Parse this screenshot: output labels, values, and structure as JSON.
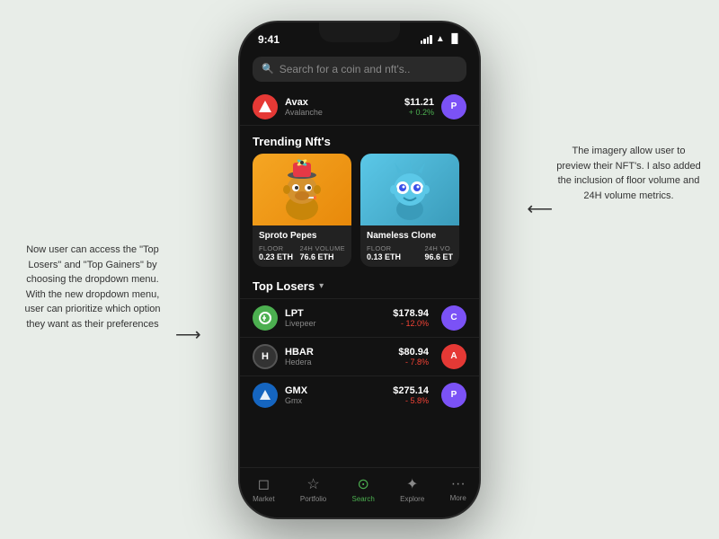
{
  "page": {
    "background": "#e8ede8"
  },
  "annotation_left": {
    "text": "Now user can access the \"Top Losers\" and \"Top Gainers\" by choosing the dropdown menu. With the new dropdown menu, user can prioritize which option they want as their preferences"
  },
  "annotation_right": {
    "text": "The imagery allow user to preview their NFT's. I also added the inclusion of floor volume and 24H volume metrics."
  },
  "status_bar": {
    "time": "9:41"
  },
  "search": {
    "placeholder": "Search for a coin and nft's.."
  },
  "avalanche_row": {
    "name": "Avax",
    "subname": "Avalanche",
    "price": "$11.21",
    "change": "+ 0.2%"
  },
  "trending_nfts": {
    "title": "Trending Nft's",
    "cards": [
      {
        "name": "Sproto Pepes",
        "floor_label": "FLOOR",
        "floor_value": "0.23 ETH",
        "volume_label": "24H VOLUME",
        "volume_value": "76.6 ETH"
      },
      {
        "name": "Nameless Clone",
        "floor_label": "FLOOR",
        "floor_value": "0.13 ETH",
        "volume_label": "24H VO",
        "volume_value": "96.6 ET"
      }
    ]
  },
  "top_losers": {
    "title": "Top Losers",
    "items": [
      {
        "ticker": "LPT",
        "name": "Livepeer",
        "price": "$178.94",
        "change": "- 12.0%",
        "color": "#4caf50"
      },
      {
        "ticker": "HBAR",
        "name": "Hedera",
        "price": "$80.94",
        "change": "- 7.8%",
        "color": "#e53935"
      },
      {
        "ticker": "GMX",
        "name": "Gmx",
        "price": "$275.14",
        "change": "- 5.8%",
        "color": "#1565c0"
      }
    ]
  },
  "nav": {
    "items": [
      {
        "label": "Market",
        "icon": "◻",
        "active": false
      },
      {
        "label": "Portfolio",
        "icon": "☆",
        "active": false
      },
      {
        "label": "Search",
        "icon": "⊙",
        "active": true
      },
      {
        "label": "Explore",
        "icon": "✈",
        "active": false
      },
      {
        "label": "More",
        "icon": "···",
        "active": false
      }
    ]
  }
}
